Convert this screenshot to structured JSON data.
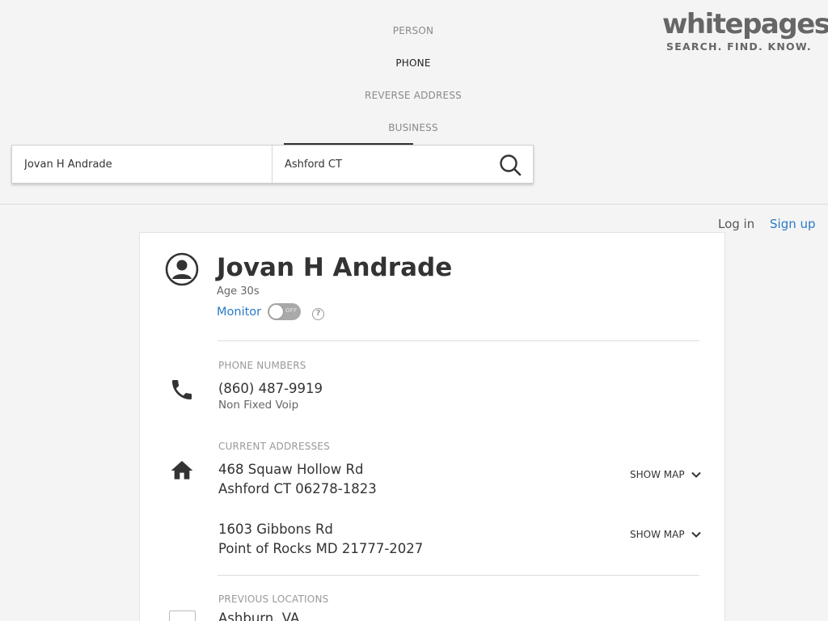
{
  "nav": {
    "person": "PERSON",
    "phone": "PHONE",
    "reverse_address": "REVERSE ADDRESS",
    "business": "BUSINESS"
  },
  "logo": {
    "name": "whitepages",
    "tagline": "SEARCH. FIND. KNOW."
  },
  "search": {
    "name_value": "Jovan H Andrade",
    "location_value": "Ashford CT"
  },
  "auth": {
    "login": "Log in",
    "signup": "Sign up"
  },
  "profile": {
    "name": "Jovan H Andrade",
    "age": "Age 30s",
    "monitor_label": "Monitor",
    "monitor_toggle": "OFF",
    "help": "?"
  },
  "phones": {
    "label": "PHONE NUMBERS",
    "items": [
      {
        "number": "(860) 487-9919",
        "type": "Non Fixed Voip"
      }
    ]
  },
  "addresses": {
    "label": "CURRENT ADDRESSES",
    "show_map": "SHOW MAP",
    "items": [
      {
        "line1": "468 Squaw Hollow Rd",
        "line2": "Ashford CT 06278-1823"
      },
      {
        "line1": "1603 Gibbons Rd",
        "line2": "Point of Rocks MD 21777-2027"
      }
    ]
  },
  "previous": {
    "label": "PREVIOUS LOCATIONS",
    "items": [
      "Ashburn, VA"
    ]
  },
  "colors": {
    "accent": "#2a7ac7",
    "background": "#f4f4f4"
  }
}
